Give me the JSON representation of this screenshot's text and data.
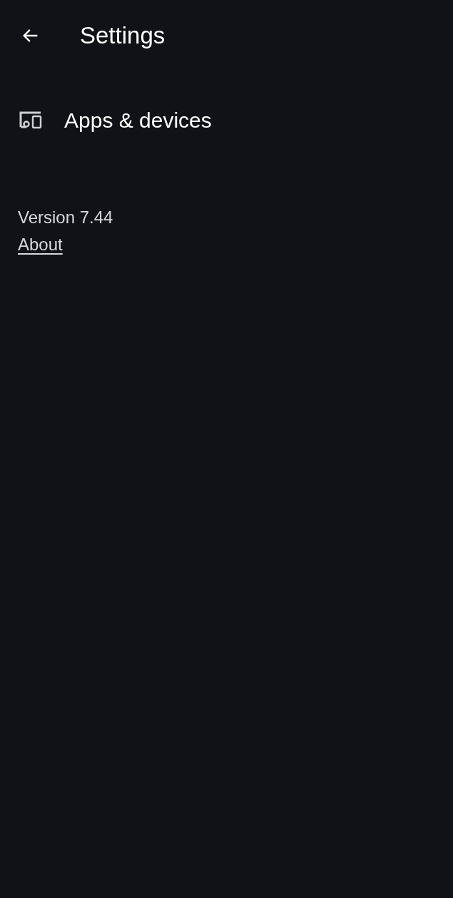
{
  "app_bar": {
    "title": "Settings"
  },
  "items": [
    {
      "label": "Apps & devices"
    }
  ],
  "footer": {
    "version": "Version 7.44",
    "link": "About"
  }
}
